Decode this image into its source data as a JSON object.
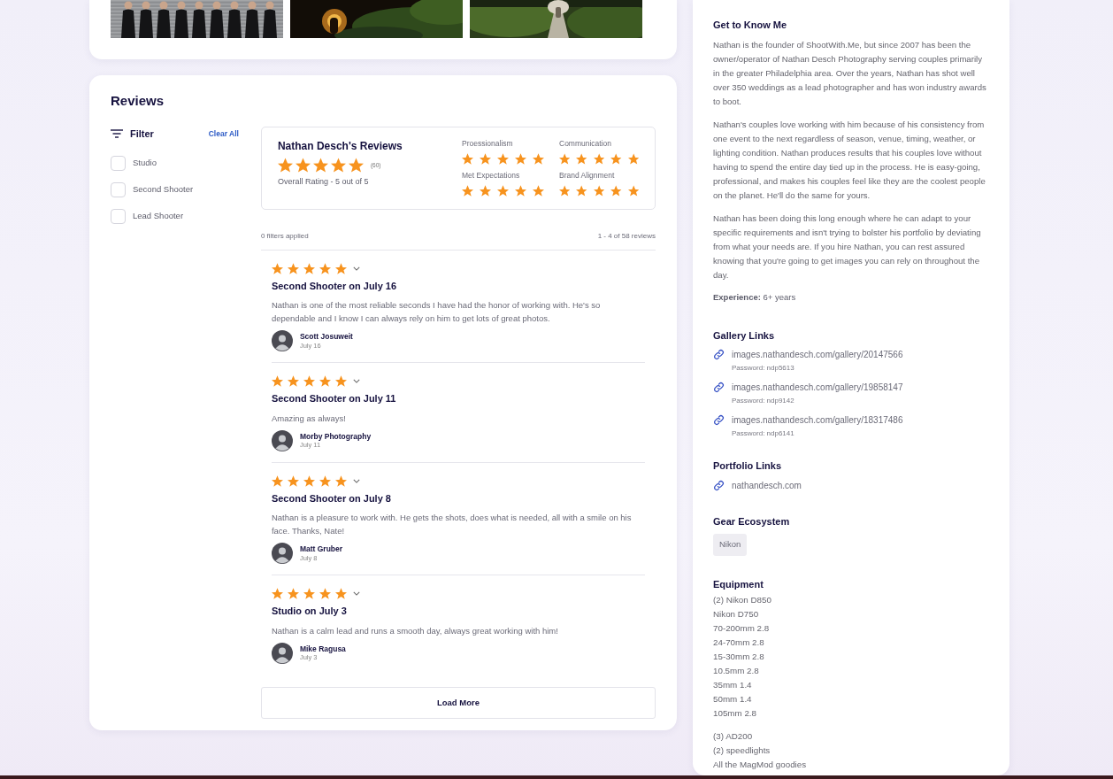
{
  "gallery": {
    "photos": [
      {
        "kind": "group"
      },
      {
        "kind": "night"
      },
      {
        "kind": "garden"
      }
    ]
  },
  "reviews": {
    "title": "Reviews",
    "filter": {
      "label": "Filter",
      "clear": "Clear All",
      "options": [
        {
          "label": "Studio",
          "checked": false
        },
        {
          "label": "Second Shooter",
          "checked": false
        },
        {
          "label": "Lead Shooter",
          "checked": false
        }
      ]
    },
    "summary": {
      "title": "Nathan Desch's Reviews",
      "stars": 5,
      "count": "(60)",
      "overall": "Overall Rating - 5 out of 5",
      "categories": [
        {
          "label": "Proessionalism",
          "stars": 5
        },
        {
          "label": "Communication",
          "stars": 5
        },
        {
          "label": "Met Expectations",
          "stars": 5
        },
        {
          "label": "Brand Alignment",
          "stars": 5
        }
      ]
    },
    "filters_applied": "0 filters applied",
    "range": "1 - 4 of 58 reviews",
    "items": [
      {
        "stars": 5,
        "title": "Second Shooter on July 16",
        "text": "Nathan is one of the most reliable seconds I have had the honor of working with. He's so dependable and I know I can always rely on him to get lots of great photos.",
        "author": "Scott Josuweit",
        "date": "July 16"
      },
      {
        "stars": 5,
        "title": "Second Shooter on July 11",
        "text": "Amazing as always!",
        "author": "Morby Photography",
        "date": "July 11"
      },
      {
        "stars": 5,
        "title": "Second Shooter on July 8",
        "text": "Nathan is a pleasure to work with. He gets the shots, does what is needed, all with a smile on his face. Thanks, Nate!",
        "author": "Matt Gruber",
        "date": "July 8"
      },
      {
        "stars": 5,
        "title": "Studio on July 3",
        "text": "Nathan is a calm lead and runs a smooth day, always great working with him!",
        "author": "Mike Ragusa",
        "date": "July 3"
      }
    ],
    "load_more": "Load More"
  },
  "about": {
    "title": "Get to Know Me",
    "paragraphs": [
      "Nathan is the founder of ShootWith.Me, but since 2007 has been the owner/operator of Nathan Desch Photography serving couples primarily in the greater Philadelphia area. Over the years, Nathan has shot well over 350 weddings as a lead photographer and has won industry awards to boot.",
      "Nathan's couples love working with him because of his consistency from one event to the next regardless of season, venue, timing, weather, or lighting condition. Nathan produces results that his couples love without having to spend the entire day tied up in the process. He is easy-going, professional, and makes his couples feel like they are the coolest people on the planet. He'll do the same for yours.",
      "Nathan has been doing this long enough where he can adapt to your specific requirements and isn't trying to bolster his portfolio by deviating from what your needs are. If you hire Nathan, you can rest assured knowing that you're going to get images you can rely on throughout the day."
    ],
    "experience": "**Experience:**  6+ years",
    "gallery_title": "Gallery Links",
    "galleries": [
      {
        "url": "images.nathandesch.com/gallery/20147566",
        "password": "Password: ndp5613"
      },
      {
        "url": "images.nathandesch.com/gallery/19858147",
        "password": "Password: ndp9142"
      },
      {
        "url": "images.nathandesch.com/gallery/18317486",
        "password": "Password: ndp6141"
      }
    ],
    "portfolio_title": "Portfolio Links",
    "portfolio": [
      {
        "url": "nathandesch.com"
      }
    ],
    "gear_title": "Gear Ecosystem",
    "gear": [
      "Nikon"
    ],
    "equipment_title": "Equipment",
    "equipment_groups": [
      [
        "(2) Nikon D850",
        "Nikon D750",
        "70-200mm 2.8",
        "24-70mm 2.8",
        "15-30mm 2.8",
        "10.5mm 2.8",
        "35mm 1.4",
        "50mm 1.4",
        "105mm 2.8"
      ],
      [
        "(3) AD200",
        "(2) speedlights",
        "All the MagMod goodies"
      ]
    ]
  }
}
